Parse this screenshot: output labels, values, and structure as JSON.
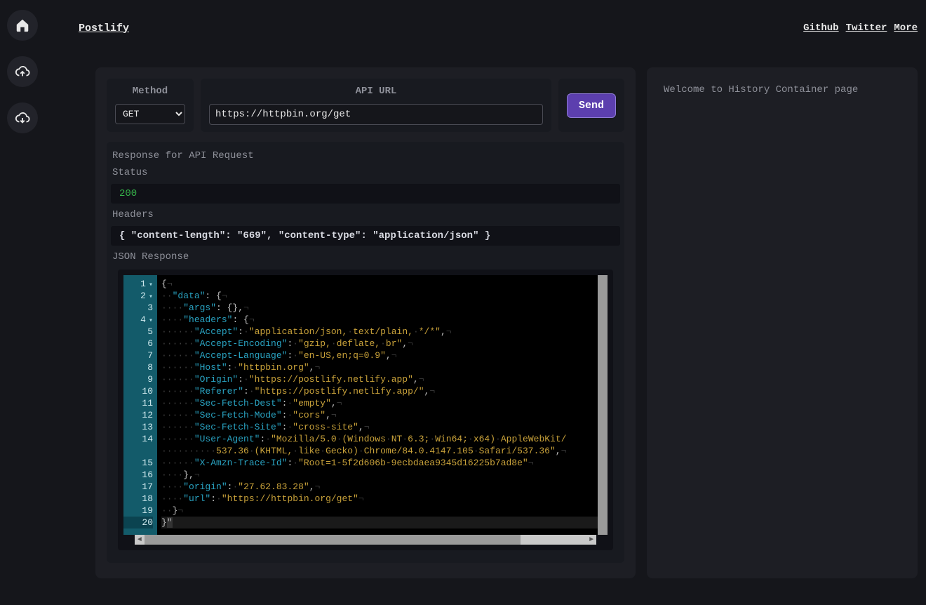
{
  "brand": "Postlify",
  "nav": {
    "github": "Github",
    "twitter": "Twitter",
    "more": "More"
  },
  "sidebar_icons": [
    "home-icon",
    "cloud-up-icon",
    "cloud-down-icon"
  ],
  "request": {
    "method_label": "Method",
    "method": "GET",
    "url_label": "API URL",
    "url": "https://httpbin.org/get",
    "send": "Send"
  },
  "response": {
    "title": "Response for API Request",
    "status_label": "Status",
    "status": "200",
    "headers_label": "Headers",
    "headers": "{ \"content-length\": \"669\", \"content-type\": \"application/json\" }",
    "json_label": "JSON Response"
  },
  "history": {
    "welcome": "Welcome to History Container page"
  },
  "json_lines": [
    {
      "n": 1,
      "fold": true,
      "indent": 0,
      "raw": "{"
    },
    {
      "n": 2,
      "fold": true,
      "indent": 2,
      "key": "data",
      "raw_after": ": {"
    },
    {
      "n": 3,
      "indent": 4,
      "key": "args",
      "raw_after": ": {},"
    },
    {
      "n": 4,
      "fold": true,
      "indent": 4,
      "key": "headers",
      "raw_after": ": {"
    },
    {
      "n": 5,
      "indent": 6,
      "key": "Accept",
      "val": "application/json, text/plain, */*",
      "comma": true
    },
    {
      "n": 6,
      "indent": 6,
      "key": "Accept-Encoding",
      "val": "gzip, deflate, br",
      "comma": true
    },
    {
      "n": 7,
      "indent": 6,
      "key": "Accept-Language",
      "val": "en-US,en;q=0.9",
      "comma": true
    },
    {
      "n": 8,
      "indent": 6,
      "key": "Host",
      "val": "httpbin.org",
      "comma": true
    },
    {
      "n": 9,
      "indent": 6,
      "key": "Origin",
      "val": "https://postlify.netlify.app",
      "comma": true
    },
    {
      "n": 10,
      "indent": 6,
      "key": "Referer",
      "val": "https://postlify.netlify.app/",
      "comma": true
    },
    {
      "n": 11,
      "indent": 6,
      "key": "Sec-Fetch-Dest",
      "val": "empty",
      "comma": true
    },
    {
      "n": 12,
      "indent": 6,
      "key": "Sec-Fetch-Mode",
      "val": "cors",
      "comma": true
    },
    {
      "n": 13,
      "indent": 6,
      "key": "Sec-Fetch-Site",
      "val": "cross-site",
      "comma": true
    },
    {
      "n": 14,
      "indent": 6,
      "key": "User-Agent",
      "val": "Mozilla/5.0 (Windows NT 6.3; Win64; x64) AppleWebKit/537.36 (KHTML, like Gecko) Chrome/84.0.4147.105 Safari/537.36",
      "comma": true,
      "wrap": 80
    },
    {
      "n": 15,
      "indent": 6,
      "key": "X-Amzn-Trace-Id",
      "val": "Root=1-5f2d606b-9ecbdaea9345d16225b7ad8e"
    },
    {
      "n": 16,
      "indent": 4,
      "raw": "},"
    },
    {
      "n": 17,
      "indent": 4,
      "key": "origin",
      "val": "27.62.83.28",
      "comma": true
    },
    {
      "n": 18,
      "indent": 4,
      "key": "url",
      "val": "https://httpbin.org/get"
    },
    {
      "n": 19,
      "indent": 2,
      "raw": "}"
    },
    {
      "n": 20,
      "indent": 0,
      "raw": "}",
      "active": true
    }
  ]
}
